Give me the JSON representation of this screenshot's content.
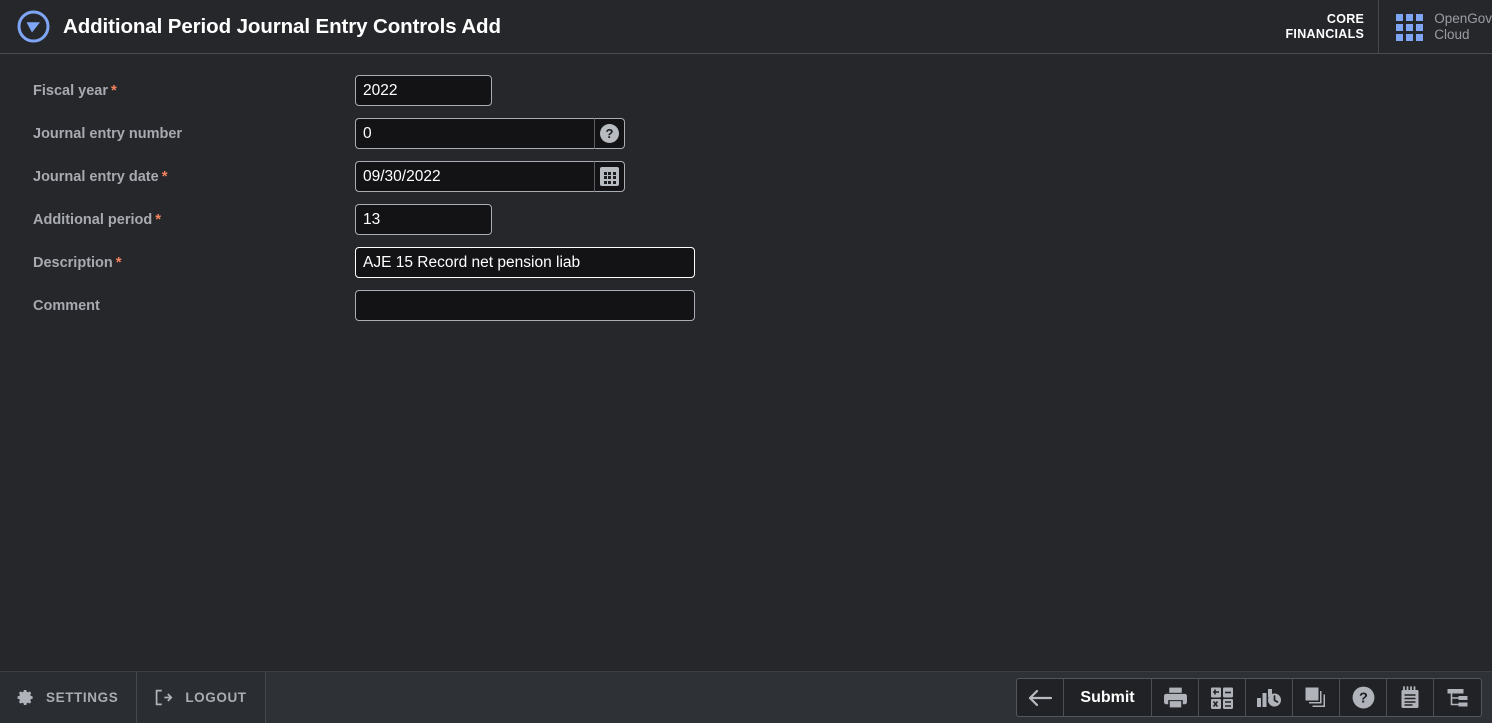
{
  "header": {
    "logo_icon": "opengov-triangle-logo",
    "title": "Additional Period Journal Entry Controls Add",
    "brand_core_line1": "CORE",
    "brand_core_line2": "FINANCIALS",
    "waffle_icon": "app-grid-icon",
    "brand_suite_line1": "OpenGov",
    "brand_suite_line2": "Cloud"
  },
  "colors": {
    "background": "#26272b",
    "bottom_bar": "#2e3136",
    "input_background": "#131315",
    "accent_blue": "#7fa6f5",
    "required_asterisk": "#f4825f",
    "label_text": "#a7aab0"
  },
  "form": {
    "required_marker": "*",
    "fields": [
      {
        "label": "Fiscal year",
        "required": true,
        "value": "2022",
        "placeholder": "",
        "width": "short",
        "adornment": null,
        "focused": false
      },
      {
        "label": "Journal entry number",
        "required": false,
        "value": "0",
        "placeholder": "",
        "width": "mid",
        "adornment": "help-icon",
        "adornment_glyph": "?",
        "focused": false
      },
      {
        "label": "Journal entry date",
        "required": true,
        "value": "09/30/2022",
        "placeholder": "",
        "width": "mid",
        "adornment": "calendar-icon",
        "adornment_glyph": "",
        "focused": false
      },
      {
        "label": "Additional period",
        "required": true,
        "value": "13",
        "placeholder": "",
        "width": "short",
        "adornment": null,
        "focused": false
      },
      {
        "label": "Description",
        "required": true,
        "value": "AJE 15 Record net pension liab",
        "placeholder": "",
        "width": "long",
        "adornment": null,
        "focused": true
      },
      {
        "label": "Comment",
        "required": false,
        "value": "",
        "placeholder": "",
        "width": "long",
        "adornment": null,
        "focused": false
      }
    ]
  },
  "bottom_bar": {
    "left_items": [
      {
        "label": "SETTINGS",
        "icon": "gear-icon"
      },
      {
        "label": "LOGOUT",
        "icon": "logout-icon"
      }
    ],
    "toolbar": [
      {
        "name": "back-button",
        "icon": "arrow-left-icon",
        "label": ""
      },
      {
        "name": "submit-button",
        "icon": "",
        "label": "Submit"
      },
      {
        "name": "print-button",
        "icon": "printer-icon",
        "label": ""
      },
      {
        "name": "calculator-button",
        "icon": "calculator-icon",
        "label": ""
      },
      {
        "name": "history-button",
        "icon": "chart-clock-icon",
        "label": ""
      },
      {
        "name": "copy-button",
        "icon": "layers-copy-icon",
        "label": ""
      },
      {
        "name": "help-button",
        "icon": "question-circle-icon",
        "label": ""
      },
      {
        "name": "notes-button",
        "icon": "notepad-icon",
        "label": ""
      },
      {
        "name": "tree-button",
        "icon": "hierarchy-tree-icon",
        "label": ""
      }
    ]
  }
}
